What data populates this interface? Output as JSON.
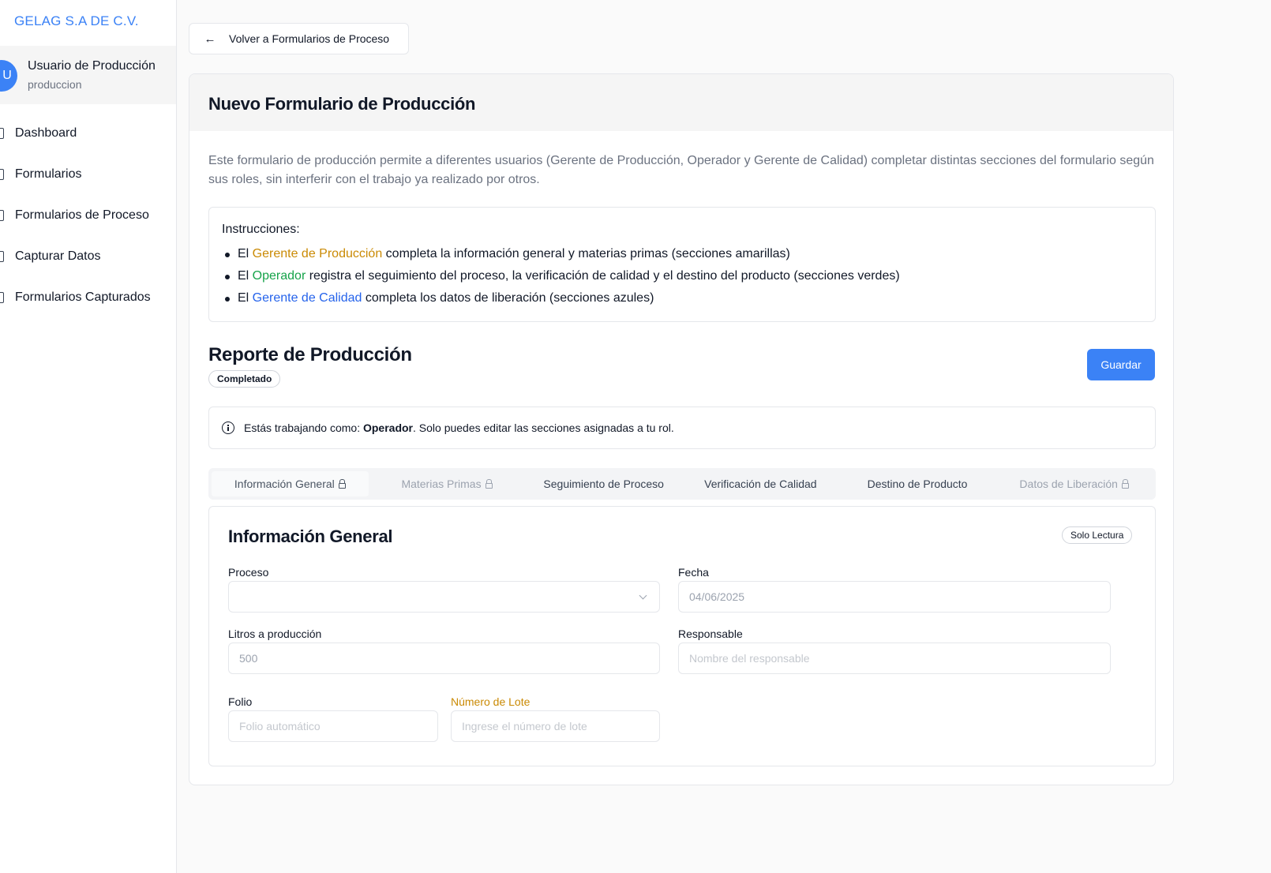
{
  "brand": "GELAG S.A DE C.V.",
  "user": {
    "initial": "U",
    "name": "Usuario de Producción",
    "role": "produccion"
  },
  "nav": [
    {
      "label": "Dashboard",
      "icon": "dashboard-icon"
    },
    {
      "label": "Formularios",
      "icon": "file-icon"
    },
    {
      "label": "Formularios de Proceso",
      "icon": "clipboard-icon"
    },
    {
      "label": "Capturar Datos",
      "icon": "pencil-icon"
    },
    {
      "label": "Formularios Capturados",
      "icon": "folder-icon"
    }
  ],
  "back_label": "Volver a Formularios de Proceso",
  "card": {
    "title": "Nuevo Formulario de Producción",
    "description": "Este formulario de producción permite a diferentes usuarios (Gerente de Producción, Operador y Gerente de Calidad) completar distintas secciones del formulario según sus roles, sin interferir con el trabajo ya realizado por otros."
  },
  "instructions": {
    "title": "Instrucciones:",
    "items": [
      {
        "prefix": "El ",
        "role": "Gerente de Producción",
        "color": "#ca8a04",
        "text": " completa la información general y materias primas (secciones amarillas)"
      },
      {
        "prefix": "El ",
        "role": "Operador",
        "color": "#16a34a",
        "text": " registra el seguimiento del proceso, la verificación de calidad y el destino del producto (secciones verdes)"
      },
      {
        "prefix": "El ",
        "role": "Gerente de Calidad",
        "color": "#2563eb",
        "text": " completa los datos de liberación (secciones azules)"
      }
    ]
  },
  "report": {
    "title": "Reporte de Producción",
    "status": "Completado",
    "save_label": "Guardar"
  },
  "role_alert": {
    "prefix": "Estás trabajando como: ",
    "role": "Operador",
    "suffix": ". Solo puedes editar las secciones asignadas a tu rol."
  },
  "tabs": [
    {
      "label": "Información General",
      "locked": true,
      "state": "active"
    },
    {
      "label": "Materias Primas",
      "locked": true,
      "state": "disabled"
    },
    {
      "label": "Seguimiento de Proceso",
      "locked": false,
      "state": "enabled"
    },
    {
      "label": "Verificación de Calidad",
      "locked": false,
      "state": "enabled"
    },
    {
      "label": "Destino de Producto",
      "locked": false,
      "state": "enabled"
    },
    {
      "label": "Datos de Liberación",
      "locked": true,
      "state": "disabled"
    }
  ],
  "section": {
    "title": "Información General",
    "badge": "Solo Lectura",
    "fields": {
      "proceso": {
        "label": "Proceso",
        "value": ""
      },
      "fecha": {
        "label": "Fecha",
        "value": "04/06/2025"
      },
      "litros": {
        "label": "Litros a producción",
        "value": "500"
      },
      "responsable": {
        "label": "Responsable",
        "placeholder": "Nombre del responsable"
      },
      "folio": {
        "label": "Folio",
        "placeholder": "Folio automático"
      },
      "lote": {
        "label": "Número de Lote",
        "placeholder": "Ingrese el número de lote"
      }
    }
  },
  "colors": {
    "accent": "#3b82f6",
    "yellow": "#ca8a04",
    "green": "#16a34a",
    "blue": "#2563eb"
  }
}
